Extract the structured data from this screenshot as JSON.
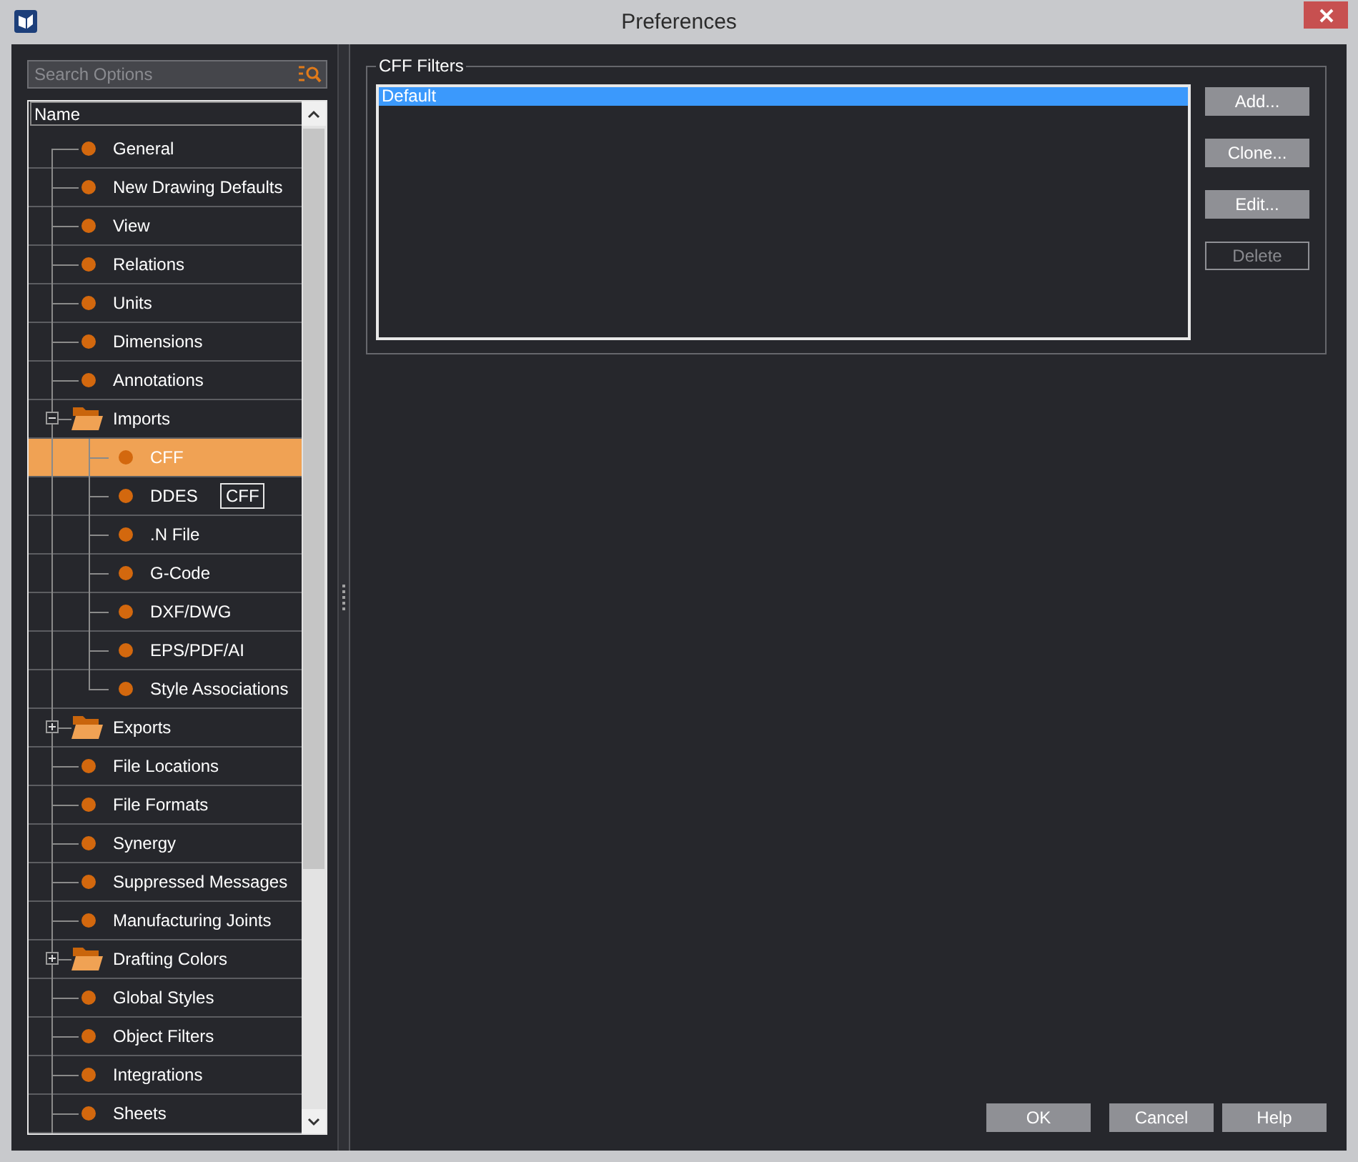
{
  "window": {
    "title": "Preferences"
  },
  "search": {
    "placeholder": "Search Options"
  },
  "tree": {
    "column": "Name",
    "items": [
      {
        "label": "General",
        "kind": "page",
        "selected": false
      },
      {
        "label": "New Drawing Defaults",
        "kind": "page",
        "selected": false
      },
      {
        "label": "View",
        "kind": "page",
        "selected": false
      },
      {
        "label": "Relations",
        "kind": "page",
        "selected": false
      },
      {
        "label": "Units",
        "kind": "page",
        "selected": false
      },
      {
        "label": "Dimensions",
        "kind": "page",
        "selected": false
      },
      {
        "label": "Annotations",
        "kind": "page",
        "selected": false
      },
      {
        "label": "Imports",
        "kind": "folder",
        "expanded": true,
        "selected": false,
        "children": [
          {
            "label": "CFF",
            "kind": "page",
            "selected": true
          },
          {
            "label": "DDES",
            "kind": "page",
            "selected": false
          },
          {
            "label": ".N File",
            "kind": "page",
            "selected": false
          },
          {
            "label": "G-Code",
            "kind": "page",
            "selected": false
          },
          {
            "label": "DXF/DWG",
            "kind": "page",
            "selected": false
          },
          {
            "label": "EPS/PDF/AI",
            "kind": "page",
            "selected": false
          },
          {
            "label": "Style Associations",
            "kind": "page",
            "selected": false
          }
        ]
      },
      {
        "label": "Exports",
        "kind": "folder",
        "expanded": false,
        "selected": false
      },
      {
        "label": "File Locations",
        "kind": "page",
        "selected": false
      },
      {
        "label": "File Formats",
        "kind": "page",
        "selected": false
      },
      {
        "label": "Synergy",
        "kind": "page",
        "selected": false
      },
      {
        "label": "Suppressed Messages",
        "kind": "page",
        "selected": false
      },
      {
        "label": "Manufacturing Joints",
        "kind": "page",
        "selected": false
      },
      {
        "label": "Drafting Colors",
        "kind": "folder",
        "expanded": false,
        "selected": false
      },
      {
        "label": "Global Styles",
        "kind": "page",
        "selected": false
      },
      {
        "label": "Object Filters",
        "kind": "page",
        "selected": false
      },
      {
        "label": "Integrations",
        "kind": "page",
        "selected": false
      },
      {
        "label": "Sheets",
        "kind": "page",
        "selected": false
      }
    ],
    "tooltip": "CFF"
  },
  "filters": {
    "title": "CFF Filters",
    "items": [
      {
        "label": "Default",
        "selected": true
      }
    ],
    "buttons": [
      {
        "label": "Add...",
        "disabled": false
      },
      {
        "label": "Clone...",
        "disabled": false
      },
      {
        "label": "Edit...",
        "disabled": false
      },
      {
        "label": "Delete",
        "disabled": true
      }
    ]
  },
  "footer_buttons": [
    "OK",
    "Cancel",
    "Help"
  ]
}
